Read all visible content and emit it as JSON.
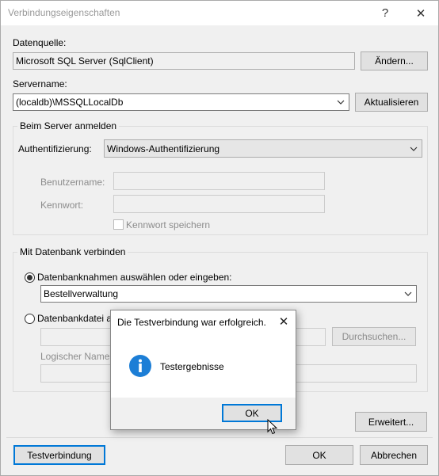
{
  "window": {
    "title": "Verbindungseigenschaften",
    "help_label": "?",
    "close_label": "✕"
  },
  "datasource": {
    "label": "Datenquelle:",
    "value": "Microsoft SQL Server (SqlClient)",
    "change_button": "Ändern..."
  },
  "server": {
    "label": "Servername:",
    "value": "(localdb)\\MSSQLLocalDb",
    "refresh_button": "Aktualisieren"
  },
  "login": {
    "group_label": "Beim Server anmelden",
    "auth_label": "Authentifizierung:",
    "auth_value": "Windows-Authentifizierung",
    "username_label": "Benutzername:",
    "username_value": "",
    "password_label": "Kennwort:",
    "password_value": "",
    "save_password_label": "Kennwort speichern",
    "save_password_checked": false
  },
  "database": {
    "group_label": "Mit Datenbank verbinden",
    "option_select_label": "Datenbanknahmen auswählen oder eingeben:",
    "option_select_checked": true,
    "db_value": "Bestellverwaltung",
    "option_file_label": "Datenbankdatei an",
    "option_file_checked": false,
    "file_value": "",
    "browse_button": "Durchsuchen...",
    "logical_name_label": "Logischer Name:",
    "logical_name_value": ""
  },
  "footer": {
    "advanced_button": "Erweitert...",
    "test_button": "Testverbindung",
    "ok_button": "OK",
    "cancel_button": "Abbrechen"
  },
  "message_box": {
    "title": "Die Testverbindung war erfolgreich.",
    "close_label": "✕",
    "icon": "info-icon",
    "text": "Testergebnisse",
    "ok_button": "OK"
  },
  "colors": {
    "accent": "#0078d7",
    "info_icon": "#1c7ed6",
    "background": "#f0f0f0"
  }
}
